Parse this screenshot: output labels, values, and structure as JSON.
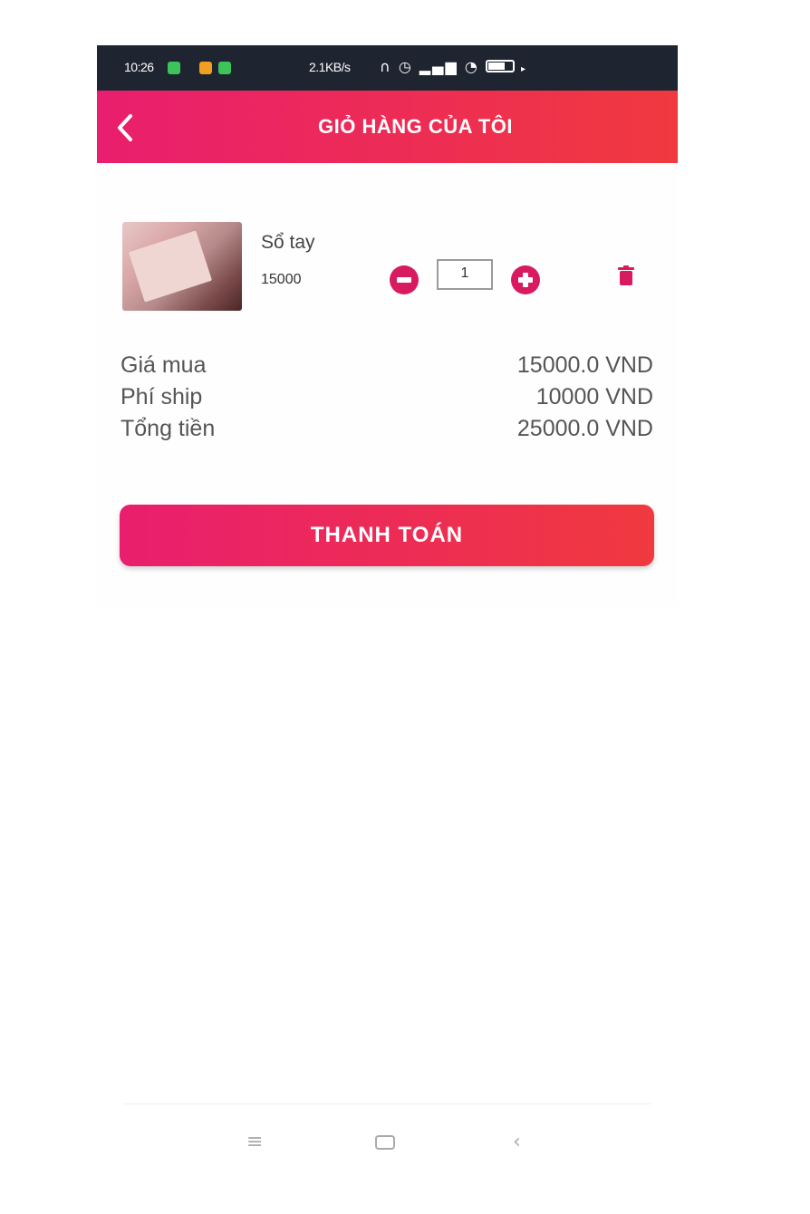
{
  "status_bar": {
    "time": "10:26",
    "network_speed": "2.1KB/s",
    "app_icon_colors": [
      "#3cc45a",
      "#f0a020",
      "#3cc45a"
    ],
    "icons": [
      "headphones-icon",
      "alarm-icon",
      "signal-icon",
      "wifi-icon",
      "battery-icon"
    ],
    "battery_label": "65"
  },
  "app_bar": {
    "title": "GIỎ HÀNG CỦA TÔI",
    "back_icon": "‹",
    "gradient": [
      "#e91e6e",
      "#f0393f"
    ]
  },
  "cart_item": {
    "name": "Sổ tay",
    "price": "15000",
    "quantity": "1",
    "minus_icon": "−",
    "plus_icon": "+",
    "accent": "#d81b60"
  },
  "summary": {
    "rows": [
      {
        "label": "Giá mua",
        "value": "15000.0 VND"
      },
      {
        "label": "Phí ship",
        "value": "10000 VND"
      },
      {
        "label": "Tổng tiền",
        "value": "25000.0 VND"
      }
    ]
  },
  "checkout_button": {
    "label": "THANH TOÁN"
  },
  "system_nav": {
    "menu_icon": "≡",
    "home_icon": "▭",
    "back_icon": "‹"
  }
}
